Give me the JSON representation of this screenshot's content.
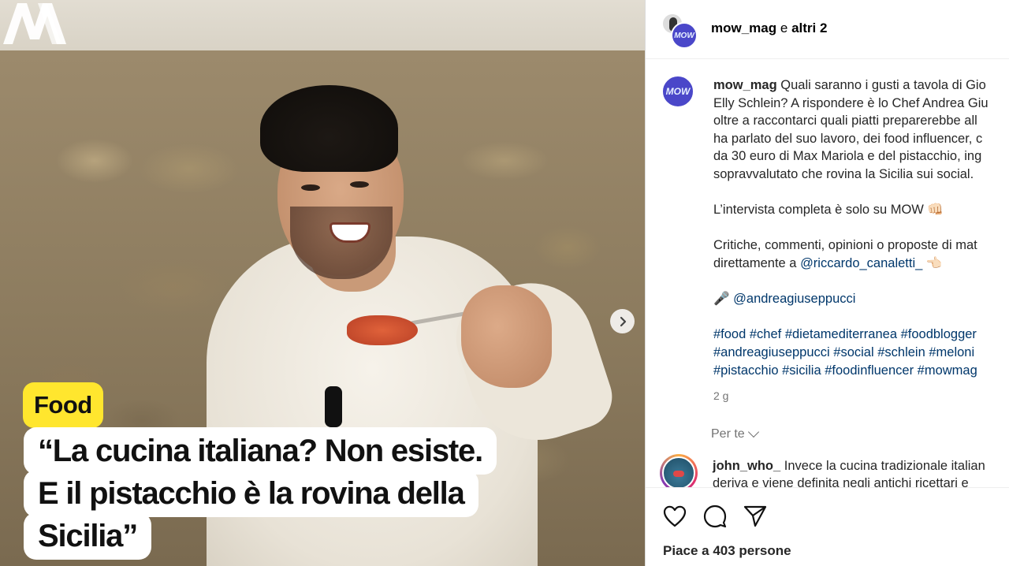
{
  "media": {
    "brand_mark": "MOW",
    "category_tag": "Food",
    "headline_lines": [
      "“La cucina italiana? Non esiste.",
      "E il pistacchio è la rovina della",
      "Sicilia”"
    ],
    "next_icon": "chevron-right-icon"
  },
  "header": {
    "avatar_label": "MOW",
    "username": "mow_mag",
    "conjunction": "e",
    "others": "altri 2"
  },
  "caption": {
    "avatar_label": "MOW",
    "username": "mow_mag",
    "lines": [
      "Quali saranno i gusti a tavola di Gio",
      "Elly Schlein? A rispondere è lo Chef Andrea Giu",
      "oltre a raccontarci quali piatti preparerebbe all",
      "ha parlato del suo lavoro, dei food influencer, c",
      "da 30 euro di Max Mariola e del pistacchio, ing",
      "sopravvalutato che rovina la Sicilia sui social."
    ],
    "interview_line": "L’intervista completa è solo su MOW 👊🏻",
    "contact_line_1": "Critiche, commenti, opinioni o proposte di mat",
    "contact_prefix": "direttamente a ",
    "contact_mention": "@riccardo_canaletti_",
    "contact_emoji": "👈🏻",
    "mic_emoji": "🎤",
    "chef_mention": "@andreagiuseppucci",
    "hashtag_lines": [
      "#food #chef #dietamediterranea #foodblogger",
      "#andreagiuseppucci #social #schlein #meloni",
      "#pistacchio #sicilia #foodinfluencer #mowmag"
    ],
    "time_ago": "2 g"
  },
  "for_you": "Per te",
  "comment": {
    "username": "john_who_",
    "line_1": "Invece la cucina tradizionale italian",
    "line_2": "deriva e viene definita negli antichi ricettari e"
  },
  "actions": {
    "like_icon": "heart-icon",
    "comment_icon": "comment-icon",
    "share_icon": "send-icon",
    "likes_text": "Piace a 403 persone"
  },
  "colors": {
    "tag_bg": "#ffe62e",
    "mow_brand": "#4a47c9",
    "link": "#00376b",
    "muted": "#737373"
  }
}
